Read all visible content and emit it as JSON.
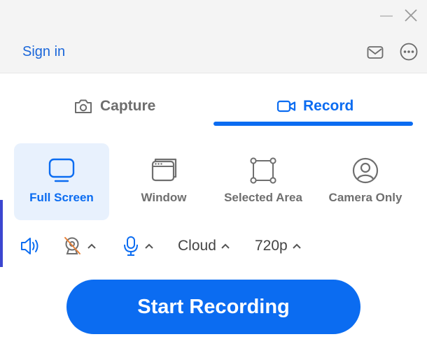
{
  "header": {
    "sign_in_label": "Sign in"
  },
  "tabs": [
    {
      "label": "Capture",
      "icon": "camera-icon",
      "active": false
    },
    {
      "label": "Record",
      "icon": "video-camera-icon",
      "active": true
    }
  ],
  "modes": [
    {
      "label": "Full Screen",
      "icon": "monitor-icon",
      "active": true
    },
    {
      "label": "Window",
      "icon": "window-icon",
      "active": false
    },
    {
      "label": "Selected Area",
      "icon": "selection-area-icon",
      "active": false
    },
    {
      "label": "Camera Only",
      "icon": "user-circle-icon",
      "active": false
    }
  ],
  "options": {
    "audio_icon": "speaker-icon",
    "webcam_icon": "webcam-off-icon",
    "mic_icon": "microphone-icon",
    "storage_value": "Cloud",
    "resolution_value": "720p"
  },
  "start_button_label": "Start Recording",
  "colors": {
    "accent": "#0b6cf1",
    "link": "#1a66d9",
    "active_tile_bg": "#e8f1fd",
    "muted_text": "#6f6f6f",
    "header_bg": "#f4f4f4",
    "webcam_off_slash": "#e8823a"
  }
}
